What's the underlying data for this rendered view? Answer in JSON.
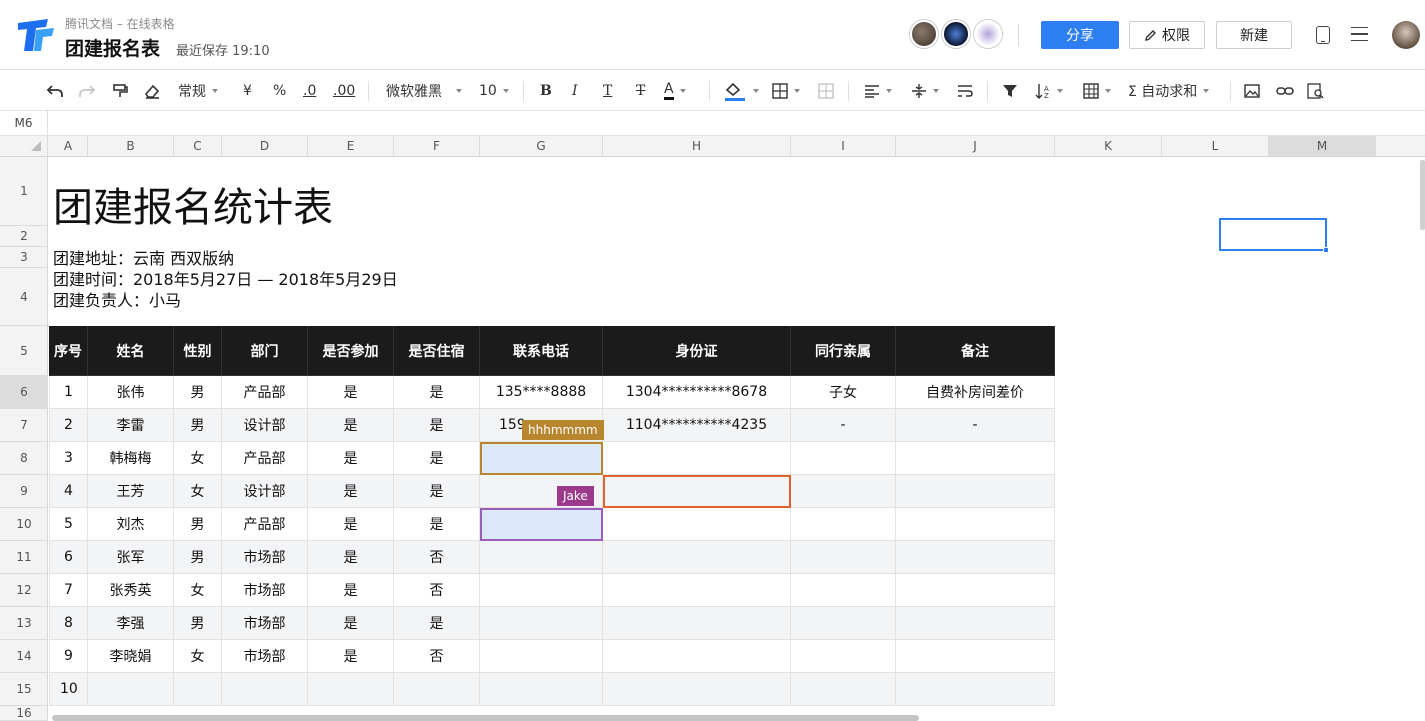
{
  "header": {
    "app_name": "腾讯文档 – 在线表格",
    "doc_title": "团建报名表",
    "save_status": "最近保存 19:10",
    "share_label": "分享",
    "permission_label": "权限",
    "new_label": "新建",
    "colors": {
      "accent": "#2d7ef0"
    }
  },
  "toolbar": {
    "format_label": "常规",
    "currency_label": "¥",
    "percent_label": "%",
    "decimal_decrease_label": ".0",
    "decimal_increase_label": ".00",
    "font_label": "微软雅黑",
    "font_size_label": "10",
    "bold_label": "B",
    "italic_label": "I",
    "underline_label": "T",
    "strike_label": "T",
    "font_color_label": "A",
    "autosum_label": "Σ 自动求和"
  },
  "name_box": "M6",
  "columns": [
    "A",
    "B",
    "C",
    "D",
    "E",
    "F",
    "G",
    "H",
    "I",
    "J",
    "K",
    "L",
    "M"
  ],
  "rows": [
    "1",
    "2",
    "3",
    "4",
    "5",
    "6",
    "7",
    "8",
    "9",
    "10",
    "11",
    "12",
    "13",
    "14",
    "15",
    "16"
  ],
  "sheet": {
    "title": "团建报名统计表",
    "info_address": "团建地址：云南 西双版纳",
    "info_time": "团建时间：2018年5月27日 — 2018年5月29日",
    "info_owner": "团建负责人：小马",
    "table_headers": [
      "序号",
      "姓名",
      "性别",
      "部门",
      "是否参加",
      "是否住宿",
      "联系电话",
      "身份证",
      "同行亲属",
      "备注"
    ],
    "table_rows": [
      [
        "1",
        "张伟",
        "男",
        "产品部",
        "是",
        "是",
        "135****8888",
        "1304**********8678",
        "子女",
        "自费补房间差价"
      ],
      [
        "2",
        "李雷",
        "男",
        "设计部",
        "是",
        "是",
        "159",
        "1104**********4235",
        "-",
        "-"
      ],
      [
        "3",
        "韩梅梅",
        "女",
        "产品部",
        "是",
        "是",
        "",
        "",
        "",
        ""
      ],
      [
        "4",
        "王芳",
        "女",
        "设计部",
        "是",
        "是",
        "",
        "",
        "",
        ""
      ],
      [
        "5",
        "刘杰",
        "男",
        "产品部",
        "是",
        "是",
        "",
        "",
        "",
        ""
      ],
      [
        "6",
        "张军",
        "男",
        "市场部",
        "是",
        "否",
        "",
        "",
        "",
        ""
      ],
      [
        "7",
        "张秀英",
        "女",
        "市场部",
        "是",
        "否",
        "",
        "",
        "",
        ""
      ],
      [
        "8",
        "李强",
        "男",
        "市场部",
        "是",
        "是",
        "",
        "",
        "",
        ""
      ],
      [
        "9",
        "李晓娟",
        "女",
        "市场部",
        "是",
        "否",
        "",
        "",
        "",
        ""
      ],
      [
        "10",
        "",
        "",
        "",
        "",
        "",
        "",
        "",
        "",
        ""
      ]
    ]
  },
  "collaborators": [
    {
      "name": "hhhmmmm",
      "color": "#b8862f"
    },
    {
      "name": "Jake",
      "color": "#9b3a8a"
    }
  ],
  "other_selection_colors": {
    "orange": "#e0622d",
    "purple": "#9b5db8"
  }
}
